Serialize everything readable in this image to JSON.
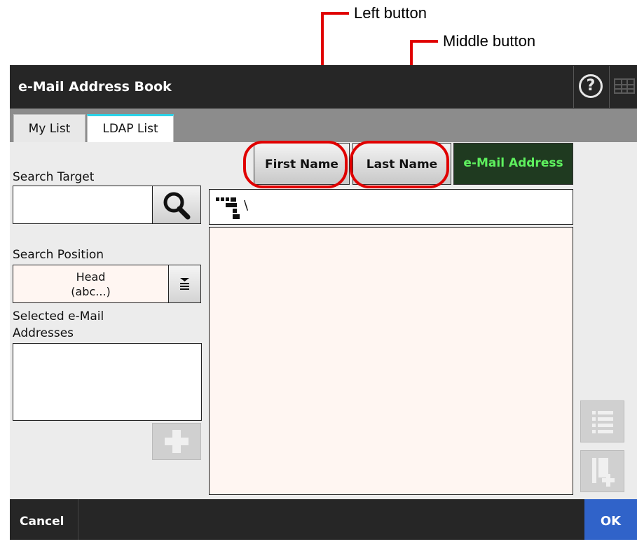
{
  "annotations": {
    "left_button": "Left button",
    "middle_button": "Middle button"
  },
  "window": {
    "title": "e-Mail Address Book",
    "help_icon": "question-circle-icon",
    "keyboard_icon": "keyboard-icon"
  },
  "tabs": [
    {
      "label": "My List",
      "active": false
    },
    {
      "label": "LDAP List",
      "active": true
    }
  ],
  "left_panel": {
    "search_target_label": "Search Target",
    "search_target_value": "",
    "search_position_label": "Search Position",
    "search_position_value_line1": "Head",
    "search_position_value_line2": "(abc...)",
    "selected_label_line1": "Selected e-Mail",
    "selected_label_line2": "Addresses"
  },
  "sort_buttons": [
    {
      "label": "First Name",
      "active": false
    },
    {
      "label": "Last Name",
      "active": false
    },
    {
      "label": "e-Mail Address",
      "active": true
    }
  ],
  "path": {
    "text": "\\",
    "icon": "ldap-tree-icon"
  },
  "bottom": {
    "cancel_label": "Cancel",
    "ok_label": "OK"
  },
  "colors": {
    "titlebar": "#262626",
    "tab_accent": "#2ad3e8",
    "active_sort_bg": "#1f3a20",
    "active_sort_text": "#5ef05e",
    "ok_button": "#3063c9",
    "callout_red": "#e00000"
  }
}
